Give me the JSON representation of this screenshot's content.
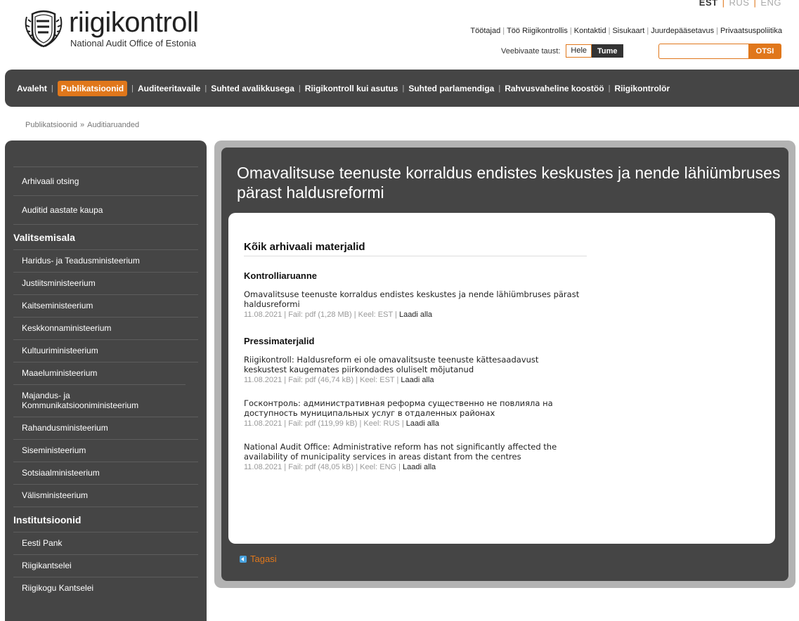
{
  "header": {
    "languages": [
      "EST",
      "RUS",
      "ENG"
    ],
    "logo_name": "riigikontroll",
    "logo_sub": "National Audit Office of Estonia",
    "top_links": [
      "Töötajad",
      "Töö Riigikontrollis",
      "Kontaktid",
      "Sisukaart",
      "Juurdepääsetavus",
      "Privaatsuspoliitika"
    ],
    "bg_label": "Veebivaate taust:",
    "bg_light": "Hele",
    "bg_dark": "Tume",
    "search_button": "OTSI"
  },
  "nav": [
    "Avaleht",
    "Publikatsioonid",
    "Auditeeritavaile",
    "Suhted avalikkusega",
    "Riigikontroll kui asutus",
    "Suhted parlamendiga",
    "Rahvusvaheline koostöö",
    "Riigikontrolör"
  ],
  "breadcrumb": [
    "Publikatsioonid",
    "Auditiaruanded"
  ],
  "sidebar": {
    "top": [
      "Arhivaali otsing",
      "Auditid aastate kaupa"
    ],
    "section1": "Valitsemisala",
    "section1_items": [
      "Haridus- ja Teadusministeerium",
      "Justiitsministeerium",
      "Kaitseministeerium",
      "Keskkonnaministeerium",
      "Kultuuriministeerium",
      "Maaeluministeerium",
      "Majandus- ja Kommunikatsiooniministeerium",
      "Rahandusministeerium",
      "Siseministeerium",
      "Sotsiaalministeerium",
      "Välisministeerium"
    ],
    "section2": "Institutsioonid",
    "section2_items": [
      "Eesti Pank",
      "Riigikantselei",
      "Riigikogu Kantselei"
    ]
  },
  "main": {
    "title": "Omavalitsuse teenuste korraldus endistes keskustes ja nende lähiümbruses pärast haldusreformi",
    "heading": "Kõik arhivaali materjalid",
    "report_heading": "Kontrolliaruanne",
    "report": {
      "title": "Omavalitsuse teenuste korraldus endistes keskustes ja nende lähiümbruses pärast haldusreformi",
      "meta": "11.08.2021 | Fail: pdf (1,28 MB) | Keel: EST | ",
      "download": "Laadi alla"
    },
    "press_heading": "Pressimaterjalid",
    "press": [
      {
        "title": "Riigikontroll: Haldusreform ei ole omavalitsuste teenuste kättesaadavust keskustest kaugemates piirkondades oluliselt mõjutanud",
        "meta": "11.08.2021 | Fail: pdf (46,74 kB) | Keel: EST | ",
        "download": "Laadi alla"
      },
      {
        "title": "Госконтроль: административная реформа существенно не повлияла на доступность муниципальных услуг в отдаленных районах",
        "meta": "11.08.2021 | Fail: pdf (119,99 kB) | Keel: RUS | ",
        "download": "Laadi alla"
      },
      {
        "title": "National Audit Office: Administrative reform has not significantly affected the availability of municipality services in areas distant from the centres",
        "meta": "11.08.2021 | Fail: pdf (48,05 kB) | Keel: ENG | ",
        "download": "Laadi alla"
      }
    ],
    "back": "Tagasi"
  },
  "colors": {
    "accent": "#e0771b",
    "dark": "#454545",
    "frame": "#b3b3b3"
  }
}
